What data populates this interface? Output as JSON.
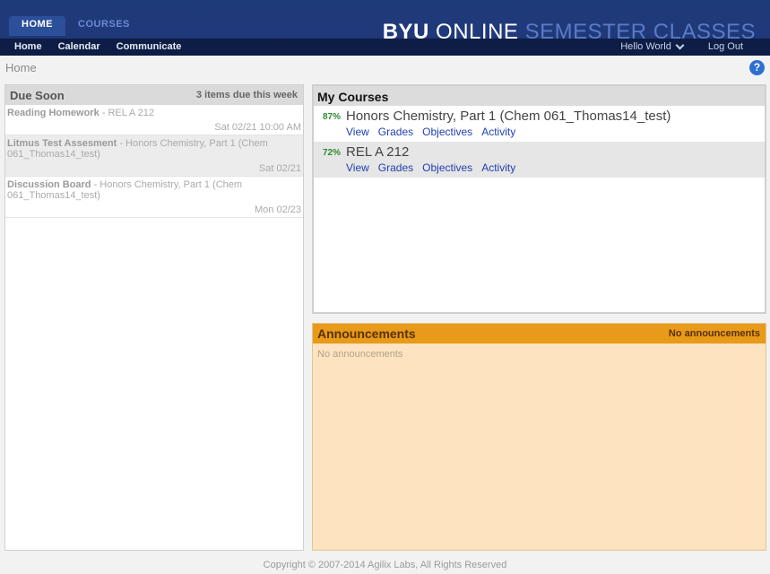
{
  "top_nav": {
    "home": "HOME",
    "courses": "COURSES"
  },
  "brand": {
    "part1": "BYU",
    "part2": "ONLINE",
    "part3": "SEMESTER CLASSES"
  },
  "sub_nav": {
    "home": "Home",
    "calendar": "Calendar",
    "communicate": "Communicate"
  },
  "user": {
    "greeting": "Hello World",
    "logout": "Log Out"
  },
  "breadcrumb": "Home",
  "help_icon": "?",
  "due_soon": {
    "title": "Due Soon",
    "count": "3 items due this week",
    "items": [
      {
        "name": "Reading Homework",
        "course": " - REL A 212",
        "date": "Sat 02/21 10:00 AM"
      },
      {
        "name": "Litmus Test Assesment",
        "course": " - Honors Chemistry, Part 1 (Chem 061_Thomas14_test)",
        "date": "Sat 02/21"
      },
      {
        "name": "Discussion Board",
        "course": " - Honors Chemistry, Part 1 (Chem 061_Thomas14_test)",
        "date": "Mon 02/23"
      }
    ]
  },
  "my_courses": {
    "title": "My Courses",
    "courses": [
      {
        "percent": "87%",
        "title": "Honors Chemistry, Part 1 (Chem 061_Thomas14_test)",
        "links": [
          "View",
          "Grades",
          "Objectives",
          "Activity"
        ]
      },
      {
        "percent": "72%",
        "title": "REL A 212",
        "links": [
          "View",
          "Grades",
          "Objectives",
          "Activity"
        ]
      }
    ]
  },
  "announcements": {
    "title": "Announcements",
    "status": "No announcements",
    "body": "No announcements"
  },
  "footer": "Copyright © 2007-2014 Agilix Labs, All Rights Reserved"
}
